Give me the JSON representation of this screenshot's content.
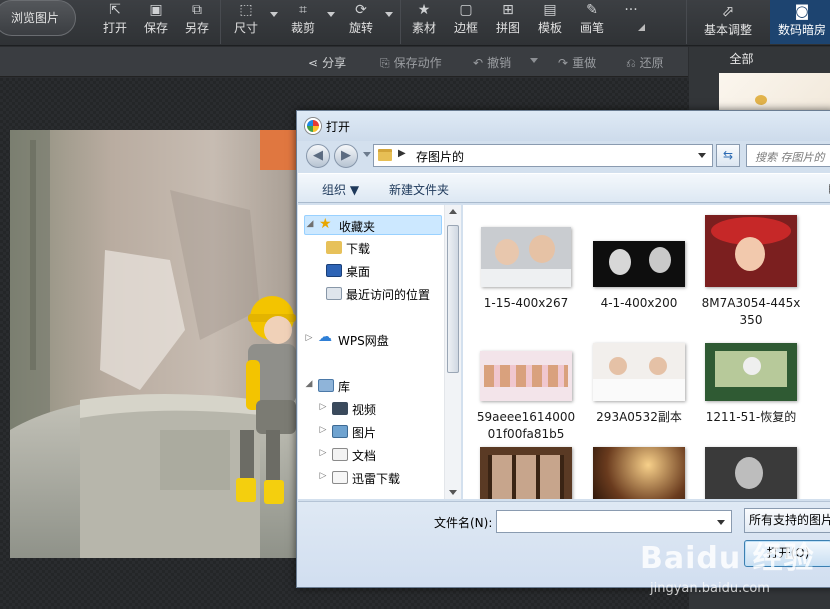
{
  "toolbar": {
    "browse_label": "浏览图片",
    "tools": [
      {
        "label": "打开",
        "icon": "open-icon"
      },
      {
        "label": "保存",
        "icon": "save-icon"
      },
      {
        "label": "另存",
        "icon": "save-as-icon"
      },
      {
        "label": "尺寸",
        "icon": "resize-icon"
      },
      {
        "label": "裁剪",
        "icon": "crop-icon"
      },
      {
        "label": "旋转",
        "icon": "rotate-icon"
      },
      {
        "label": "素材",
        "icon": "material-icon"
      },
      {
        "label": "边框",
        "icon": "frame-icon"
      },
      {
        "label": "拼图",
        "icon": "collage-icon"
      },
      {
        "label": "模板",
        "icon": "template-icon"
      },
      {
        "label": "画笔",
        "icon": "brush-icon"
      }
    ],
    "more_label": "···",
    "tab_basic": "基本调整",
    "tab_dark": "数码暗房"
  },
  "actionbar": {
    "share": "分享",
    "save_action": "保存动作",
    "undo": "撤销",
    "redo": "重做",
    "restore": "还原"
  },
  "right_panel": {
    "all_label": "全部"
  },
  "dialog": {
    "title": "打开",
    "address": "存图片的",
    "search_placeholder": "搜索 存图片的",
    "organize": "组织 ▼",
    "new_folder": "新建文件夹",
    "nav": {
      "favorites": "收藏夹",
      "downloads": "下载",
      "desktop": "桌面",
      "recent": "最近访问的位置",
      "wps": "WPS网盘",
      "library": "库",
      "videos": "视频",
      "pictures": "图片",
      "documents": "文档",
      "thunder": "迅雷下载"
    },
    "files": [
      {
        "name": "1-15-400x267"
      },
      {
        "name": "4-1-400x200"
      },
      {
        "name": "8M7A3054-445x350"
      },
      {
        "name": "59aeee161400001f00fa81b5"
      },
      {
        "name": "293A0532副本"
      },
      {
        "name": "1211-51-恢复的"
      },
      {
        "name": ""
      },
      {
        "name": ""
      },
      {
        "name": ""
      }
    ],
    "filename_label": "文件名(N):",
    "filename_value": "",
    "filter": "所有支持的图片",
    "open_button": "打开(O)"
  },
  "watermark": {
    "logo": "Baidu 经验",
    "url": "jingyan.baidu.com"
  },
  "colors": {
    "accent_tab": "#1d4470",
    "dialog_frame": "#d3e0ee",
    "selection": "#cce8ff"
  }
}
